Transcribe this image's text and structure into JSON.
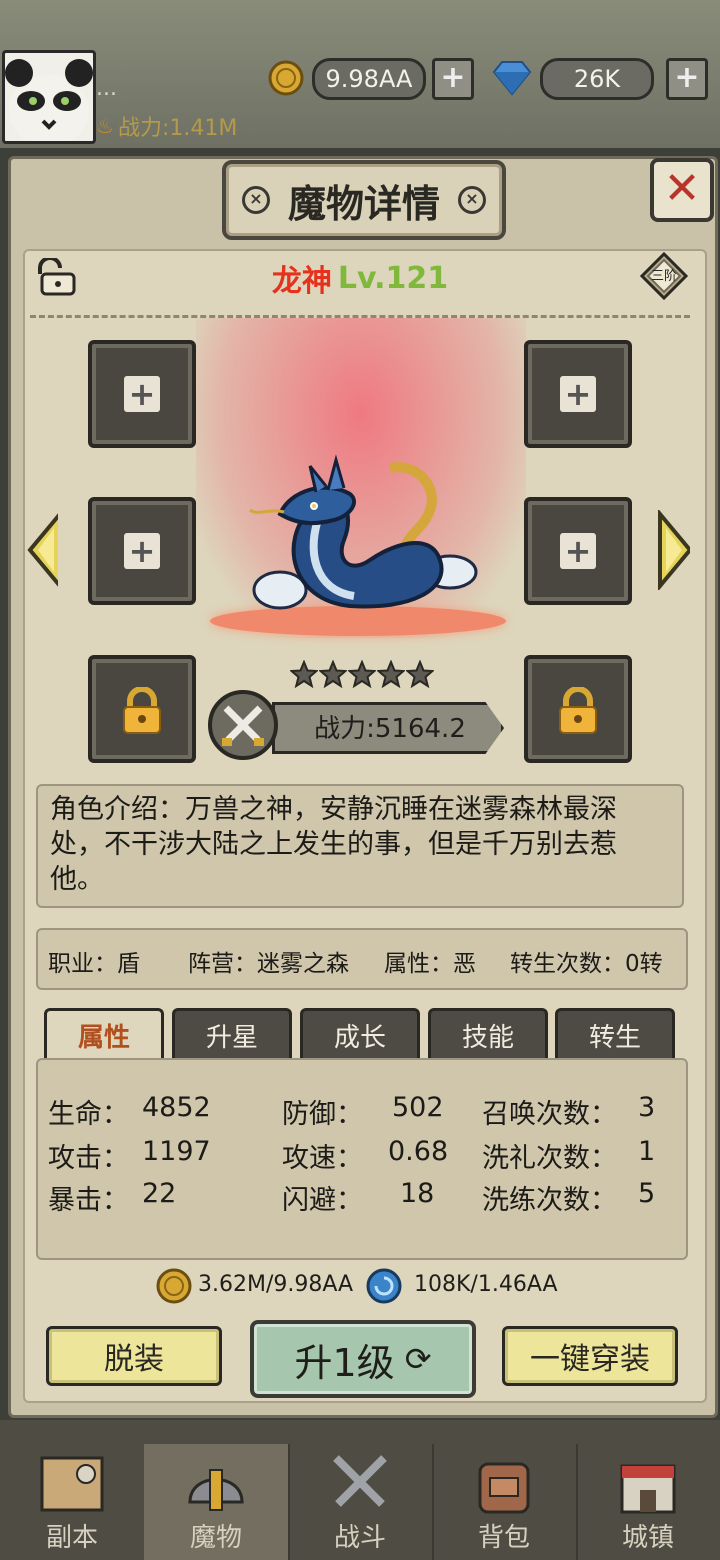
{
  "player": {
    "power": "战力:1.41M",
    "gold": "9.98AA",
    "gems": "26K",
    "name_placeholder": "..."
  },
  "panel": {
    "title": "魔物详情",
    "close": "✕"
  },
  "monster": {
    "name": "龙神",
    "level": "Lv.121",
    "rank_badge": "三阶",
    "stars": 5,
    "power": "战力:5164.2"
  },
  "description": "角色介绍：万兽之神，安静沉睡在迷雾森林最深处，不干涉大陆之上发生的事，但是千万别去惹他。",
  "info": {
    "job": "职业：盾",
    "camp": "阵营：迷雾之森",
    "attr": "属性：恶",
    "rebirth": "转生次数：0转"
  },
  "tabs": [
    "属性",
    "升星",
    "成长",
    "技能",
    "转生"
  ],
  "stats": {
    "hp_label": "生命：",
    "hp": "4852",
    "atk_label": "攻击：",
    "atk": "1197",
    "crit_label": "暴击：",
    "crit": "22",
    "def_label": "防御：",
    "def": "502",
    "spd_label": "攻速：",
    "spd": "0.68",
    "dodge_label": "闪避：",
    "dodge": "18",
    "summon_label": "召唤次数：",
    "summon": "3",
    "baptize_label": "洗礼次数：",
    "baptize": "1",
    "refine_label": "洗练次数：",
    "refine": "5"
  },
  "costs": {
    "gold": "3.62M/9.98AA",
    "essence": "108K/1.46AA"
  },
  "buttons": {
    "unequip": "脱装",
    "levelup": "升1级",
    "equip_all": "一键穿装"
  },
  "nav": [
    "副本",
    "魔物",
    "战斗",
    "背包",
    "城镇"
  ],
  "colors": {
    "name_red": "#e5321f",
    "level_green": "#7fb83a",
    "active_tab_text": "#b1501e",
    "power_plate": "#8d8a7e"
  }
}
